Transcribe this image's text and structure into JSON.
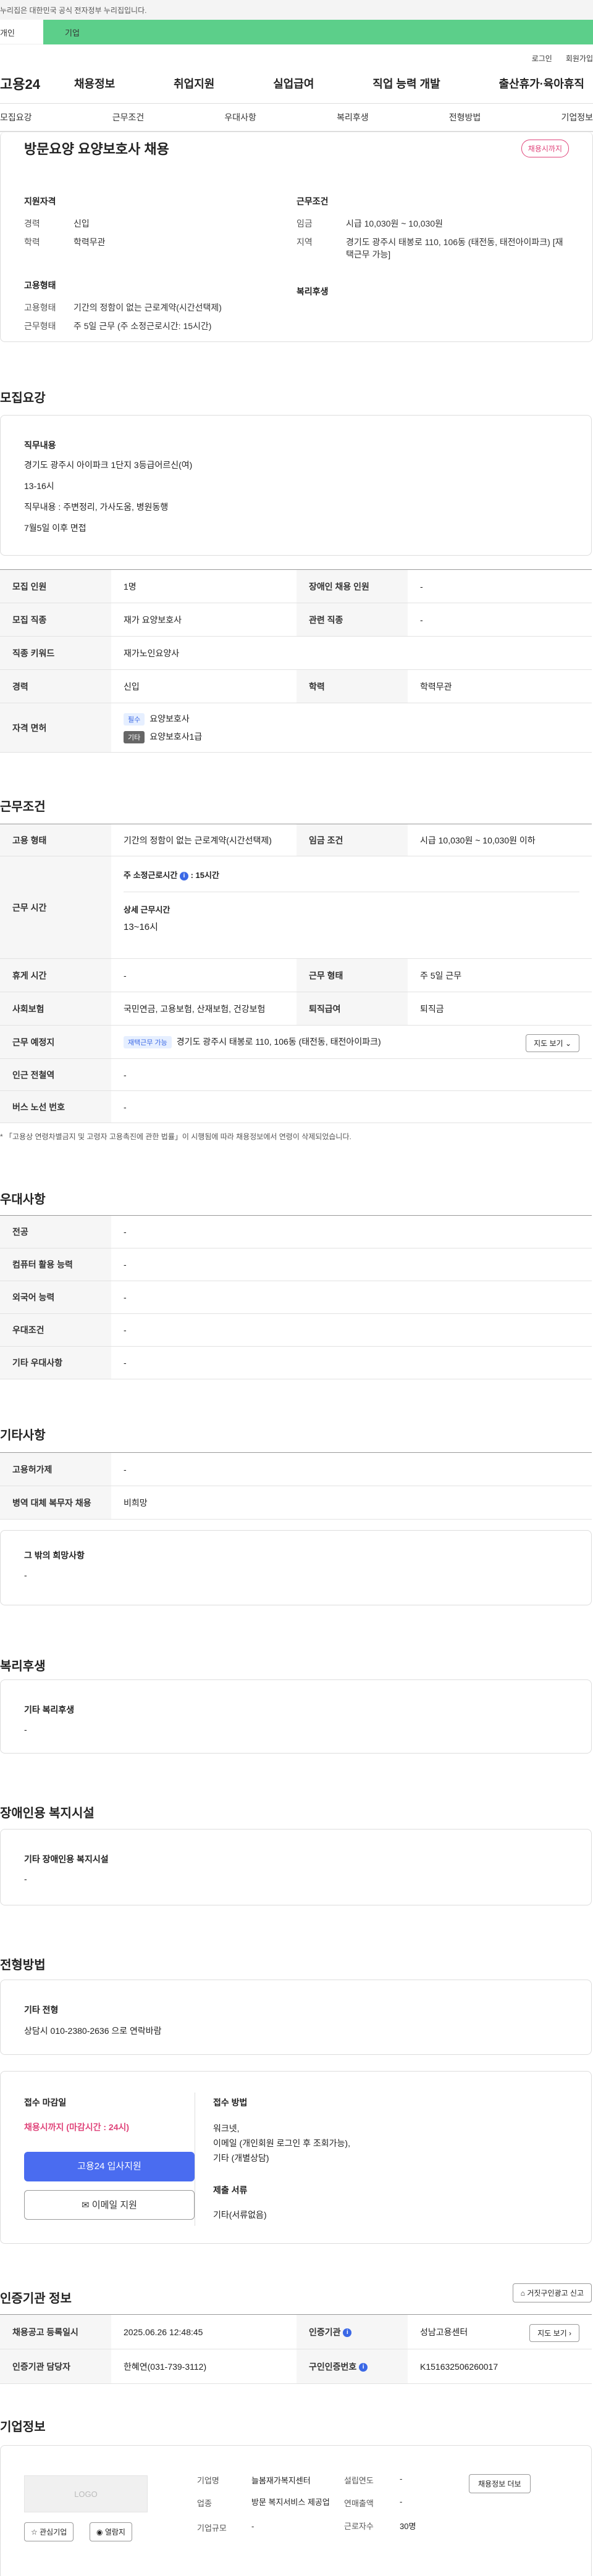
{
  "gov_banner": "누리집은 대한민국 공식 전자정부 누리집입니다.",
  "brand_bar": {
    "left": "개인",
    "right": "기업"
  },
  "util_links": [
    "로그인",
    "회원가입"
  ],
  "logo": "고용24",
  "gnb": [
    "채용정보",
    "취업지원",
    "실업급여",
    "직업 능력 개발",
    "출산휴가·육아휴직"
  ],
  "tabs": [
    "모집요강",
    "근무조건",
    "우대사항",
    "복리후생",
    "전형방법",
    "기업정보"
  ],
  "job": {
    "title": "방문요양 요양보호사 채용",
    "status": "채용시까지",
    "qual_heading": "지원자격",
    "qual": [
      {
        "k": "경력",
        "v": "신입"
      },
      {
        "k": "학력",
        "v": "학력무관"
      }
    ],
    "emp_heading": "고용형태",
    "emp": [
      {
        "k": "고용형태",
        "v": "기간의 정함이 없는 근로계약(시간선택제)"
      },
      {
        "k": "근무형태",
        "v": "주 5일 근무 (주 소정근로시간: 15시간)"
      }
    ],
    "cond_heading": "근무조건",
    "cond": [
      {
        "k": "임금",
        "v": "시급 10,030원 ~ 10,030원"
      },
      {
        "k": "지역",
        "v": "경기도 광주시 태봉로 110, 106동 (태전동, 태전아이파크) [재택근무 가능]"
      }
    ],
    "welfare_heading": "복리후생"
  },
  "recruit": {
    "heading": "모집요강",
    "duty_heading": "직무내용",
    "duty_lines": [
      "경기도 광주시 아이파크 1단지 3등급어르신(여)",
      "13-16시",
      "직무내용 : 주변정리, 가사도움, 병원동행",
      "7월5일 이후 면접"
    ],
    "rows": {
      "count_k": "모집 인원",
      "count_v": "1명",
      "disabled_k": "장애인 채용 인원",
      "disabled_v": "-",
      "job_k": "모집 직종",
      "job_v": "재가 요양보호사",
      "related_k": "관련 직종",
      "related_v": "-",
      "keyword_k": "직종 키워드",
      "keyword_v": "재가노인요양사",
      "career_k": "경력",
      "career_v": "신입",
      "edu_k": "학력",
      "edu_v": "학력무관",
      "license_k": "자격 면허",
      "license": [
        {
          "chip": "필수",
          "v": "요양보호사"
        },
        {
          "chip": "기타",
          "v": "요양보호사1급"
        }
      ]
    }
  },
  "work": {
    "heading": "근무조건",
    "emp_k": "고용 형태",
    "emp_v": "기간의 정함이 없는 근로계약(시간선택제)",
    "wage_k": "임금 조건",
    "wage_v": "시급 10,030원 ~ 10,030원 이하",
    "hours_k": "근무 시간",
    "hours_main": "주 소정근로시간",
    "hours_main_v": ": 15시간",
    "hours_detail_h": "상세 근무시간",
    "hours_detail_v": "13~16시",
    "rest_k": "휴게 시간",
    "rest_v": "-",
    "shape_k": "근무 형태",
    "shape_v": "주 5일 근무",
    "insure_k": "사회보험",
    "insure_v": "국민연금, 고용보험, 산재보험, 건강보험",
    "retire_k": "퇴직급여",
    "retire_v": "퇴직금",
    "place_k": "근무 예정지",
    "place_chip": "재택근무 가능",
    "place_v": "경기도 광주시 태봉로 110, 106동 (태전동, 태전아이파크)",
    "map_btn": "지도 보기",
    "subway_k": "인근 전철역",
    "subway_v": "-",
    "bus_k": "버스 노선 번호",
    "bus_v": "-",
    "note": "* 「고용상 연령차별금지 및 고령자 고용촉진에 관한 법률」이 시행됨에 따라 채용정보에서 연령이 삭제되었습니다."
  },
  "prefer": {
    "heading": "우대사항",
    "rows": [
      {
        "k": "전공",
        "v": "-"
      },
      {
        "k": "컴퓨터 활용 능력",
        "v": "-"
      },
      {
        "k": "외국어 능력",
        "v": "-"
      },
      {
        "k": "우대조건",
        "v": "-"
      },
      {
        "k": "기타 우대사항",
        "v": "-"
      }
    ]
  },
  "etc": {
    "heading": "기타사항",
    "rows": [
      {
        "k": "고용허가제",
        "v": "-"
      },
      {
        "k": "병역 대체 복무자 채용",
        "v": "비희망"
      }
    ],
    "other_h": "그 밖의 희망사항",
    "other_v": "-"
  },
  "welfare": {
    "heading": "복리후생",
    "box_h": "기타 복리후생",
    "box_v": "-"
  },
  "disabled": {
    "heading": "장애인용 복지시설",
    "box_h": "기타 장애인용 복지시설",
    "box_v": "-"
  },
  "screen": {
    "heading": "전형방법",
    "box_h": "기타 전형",
    "box_v": "상담시 010-2380-2636 으로 연락바람",
    "deadline_h": "접수 마감일",
    "deadline_v": "채용시까지 (마감시간 : 24시)",
    "apply_btn": "고용24 입사지원",
    "email_btn": "이메일 지원",
    "method_h": "접수 방법",
    "method_lines": [
      "워크넷,",
      "이메일 (개인회원 로그인 후 조회가능),",
      "기타 (개별상담)"
    ],
    "docs_h": "제출 서류",
    "docs_v": "기타(서류없음)"
  },
  "cert": {
    "heading": "인증기관 정보",
    "report_btn": "거짓구인광고 신고",
    "reg_k": "채용공고 등록일시",
    "reg_v": "2025.06.26 12:48:45",
    "org_k": "인증기관",
    "org_v": "성남고용센터",
    "map_btn": "지도 보기",
    "mgr_k": "인증기관 담당자",
    "mgr_v": "한혜연(031-739-3112)",
    "no_k": "구인인증번호",
    "no_v": "K151632506260017"
  },
  "company": {
    "heading": "기업정보",
    "logo_text": "LOGO",
    "fav_btn": "관심기업",
    "list_btn": "열람지",
    "name_k": "기업명",
    "name_v": "늘봄재가복지센터",
    "industry_k": "업종",
    "industry_v": "방문 복지서비스 제공업",
    "size_k": "기업규모",
    "size_v": "-",
    "year_k": "설립연도",
    "year_v": "-",
    "sales_k": "연매출액",
    "sales_v": "-",
    "staff_k": "근로자수",
    "staff_v": "30명",
    "more_btn": "채용정보 더보"
  },
  "colors": {
    "accent": "#4a6cf0",
    "brand_green": "#5ccf8a",
    "status_pink": "#e0457b"
  }
}
